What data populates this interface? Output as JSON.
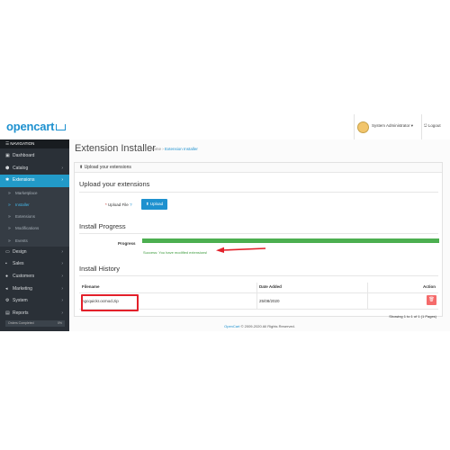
{
  "header": {
    "logo": "opencart",
    "user_name": "System Administrator",
    "user_caret": "▾",
    "logout_icon": "⎋",
    "logout_label": "Logout"
  },
  "sidebar": {
    "nav_icon": "☰",
    "nav_title": "NAVIGATION",
    "items": [
      {
        "label": "Dashboard",
        "icon": "▣",
        "chevron": ""
      },
      {
        "label": "Catalog",
        "icon": "⬢",
        "chevron": "›"
      },
      {
        "label": "Extensions",
        "icon": "✱",
        "chevron": "›"
      },
      {
        "label": "Marketplace",
        "icon": "»"
      },
      {
        "label": "Installer",
        "icon": "»"
      },
      {
        "label": "Extensions",
        "icon": "»"
      },
      {
        "label": "Modifications",
        "icon": "»"
      },
      {
        "label": "Events",
        "icon": "»"
      },
      {
        "label": "Design",
        "icon": "▭",
        "chevron": "›"
      },
      {
        "label": "Sales",
        "icon": "▪",
        "chevron": "›"
      },
      {
        "label": "Customers",
        "icon": "●",
        "chevron": "›"
      },
      {
        "label": "Marketing",
        "icon": "◂",
        "chevron": "›"
      },
      {
        "label": "System",
        "icon": "⚙",
        "chevron": "›"
      },
      {
        "label": "Reports",
        "icon": "▤",
        "chevron": "›"
      }
    ],
    "orders_completed": "Orders Completed",
    "orders_pct": "0%"
  },
  "content": {
    "page_title": "Extension Installer",
    "breadcrumb_home": "Home",
    "breadcrumb_sep": "›",
    "breadcrumb_current": "Extension Installer",
    "panel_icon": "⬆",
    "panel_heading": "Upload your extensions",
    "upload_section_title": "Upload your extensions",
    "upload_label_req": "*",
    "upload_label": "Upload File",
    "upload_help": "?",
    "upload_button": "⬆ Upload",
    "progress_section_title": "Install Progress",
    "progress_label": "Progress",
    "progress_value": 1.0,
    "progress_message": "Success: You have modified extensions!",
    "history_section_title": "Install History",
    "history_columns": [
      "Filename",
      "Date Added",
      "Action"
    ],
    "history_rows": [
      {
        "filename": "ngcquickr.ocmod.zip",
        "date_added": "25/08/2020",
        "action": "🗑"
      }
    ],
    "showing": "Showing 1 to 1 of 1 (1 Pages)"
  },
  "footer": {
    "brand": "OpenCart",
    "rest": " © 2009-2020 All Rights Reserved."
  },
  "colors": {
    "accent": "#1e91cf",
    "sidebar": "#2a3037",
    "success": "#4caf50",
    "danger": "#f56b6b",
    "highlight": "#e3202a"
  }
}
